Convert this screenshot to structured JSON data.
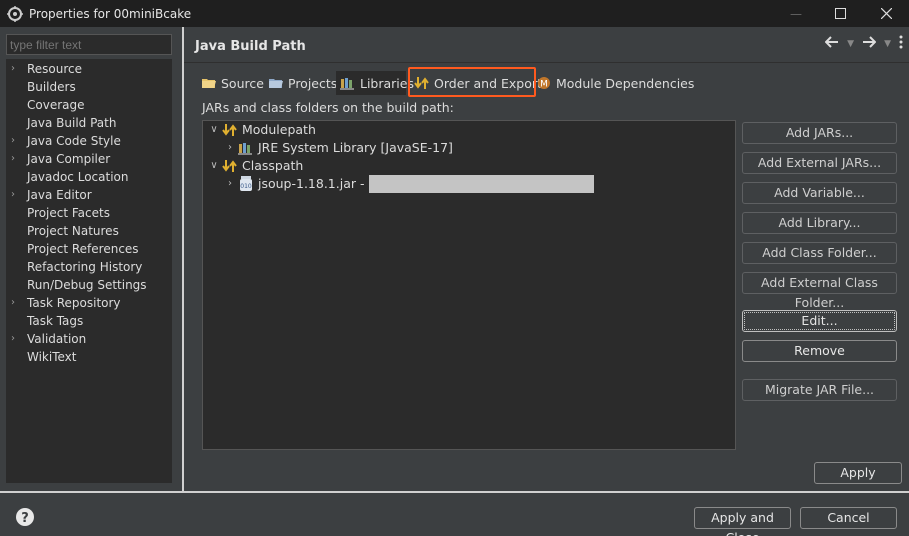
{
  "window": {
    "title": "Properties for 00miniBcake"
  },
  "filter": {
    "placeholder": "type filter text"
  },
  "sidebar": {
    "items": [
      {
        "label": "Resource",
        "expandable": true
      },
      {
        "label": "Builders",
        "expandable": false
      },
      {
        "label": "Coverage",
        "expandable": false
      },
      {
        "label": "Java Build Path",
        "expandable": false
      },
      {
        "label": "Java Code Style",
        "expandable": true
      },
      {
        "label": "Java Compiler",
        "expandable": true
      },
      {
        "label": "Javadoc Location",
        "expandable": false
      },
      {
        "label": "Java Editor",
        "expandable": true
      },
      {
        "label": "Project Facets",
        "expandable": false
      },
      {
        "label": "Project Natures",
        "expandable": false
      },
      {
        "label": "Project References",
        "expandable": false
      },
      {
        "label": "Refactoring History",
        "expandable": false
      },
      {
        "label": "Run/Debug Settings",
        "expandable": false
      },
      {
        "label": "Task Repository",
        "expandable": true
      },
      {
        "label": "Task Tags",
        "expandable": false
      },
      {
        "label": "Validation",
        "expandable": true
      },
      {
        "label": "WikiText",
        "expandable": false
      }
    ]
  },
  "page": {
    "title": "Java Build Path"
  },
  "tabs": [
    {
      "label": "Source",
      "icon": "source-folder-icon"
    },
    {
      "label": "Projects",
      "icon": "projects-icon"
    },
    {
      "label": "Libraries",
      "icon": "libraries-icon"
    },
    {
      "label": "Order and Export",
      "icon": "order-export-icon"
    },
    {
      "label": "Module Dependencies",
      "icon": "module-dependencies-icon"
    }
  ],
  "libraries": {
    "section_label": "JARs and class folders on the build path:",
    "tree": {
      "modulepath": "Modulepath",
      "jre": "JRE System Library [JavaSE-17]",
      "classpath": "Classpath",
      "jar": "jsoup-1.18.1.jar -"
    }
  },
  "buttons": {
    "add_jars": "Add JARs...",
    "add_external_jars": "Add External JARs...",
    "add_variable": "Add Variable...",
    "add_library": "Add Library...",
    "add_class_folder": "Add Class Folder...",
    "add_external_class_folder": "Add External Class Folder...",
    "edit": "Edit...",
    "remove": "Remove",
    "migrate": "Migrate JAR File...",
    "apply": "Apply",
    "apply_close": "Apply and Close",
    "cancel": "Cancel"
  },
  "colors": {
    "highlight": "#ff5a1f",
    "background": "#3c3f41",
    "tree_bg": "#2b2b2b"
  }
}
